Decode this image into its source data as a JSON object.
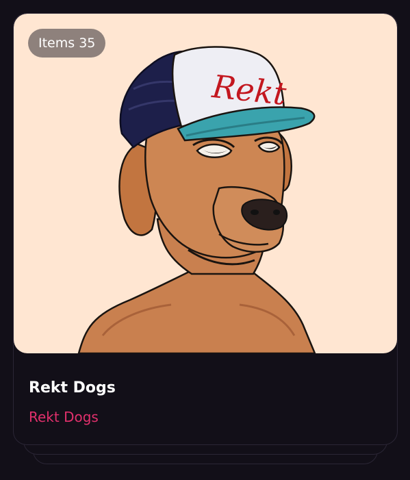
{
  "card": {
    "badge_text": "Items 35",
    "title": "Rekt Dogs",
    "collection": "Rekt Dogs",
    "cap_text": "Rekt"
  },
  "icons": {
    "artwork": "rekt-dog-nft-artwork"
  },
  "colors": {
    "page_background": "#120f18",
    "card_border": "#2b2636",
    "art_background": "#ffe6d2",
    "collection_link": "#e1306c",
    "badge_background": "#6e6464",
    "title_text": "#ffffff"
  }
}
